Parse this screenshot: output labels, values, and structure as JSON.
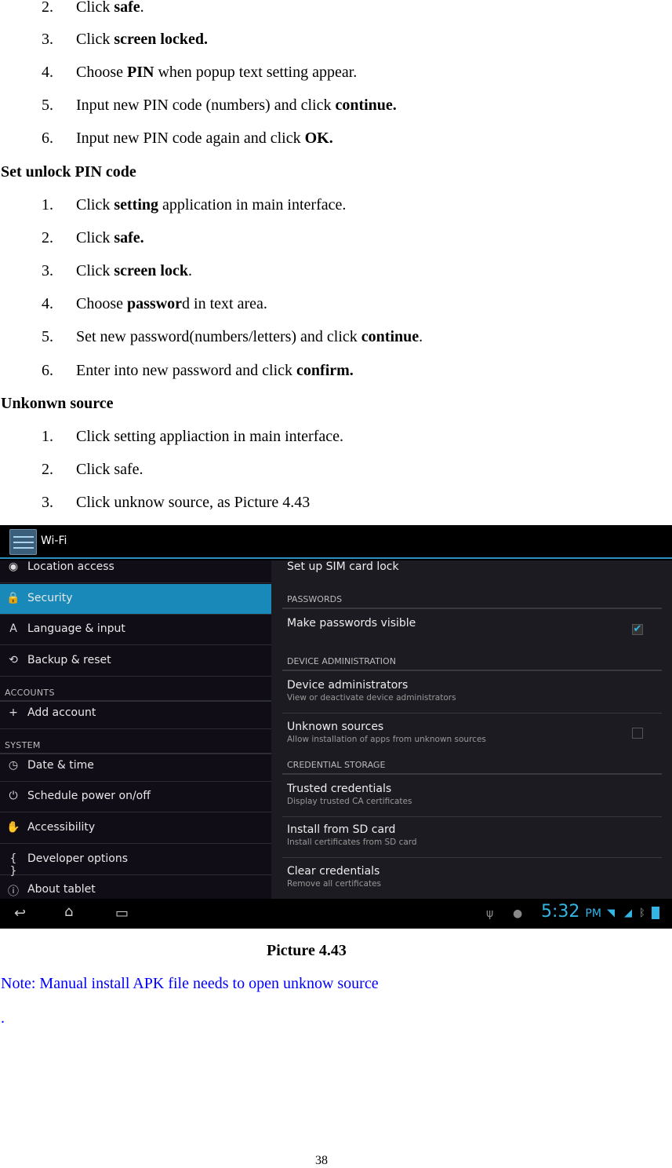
{
  "steps_a": [
    {
      "n": "2.",
      "parts": [
        [
          "Click ",
          0
        ],
        [
          "safe",
          1
        ],
        [
          ".",
          0
        ]
      ]
    },
    {
      "n": "3.",
      "parts": [
        [
          "Click ",
          0
        ],
        [
          "screen locked.",
          1
        ]
      ]
    },
    {
      "n": "4.",
      "parts": [
        [
          "Choose ",
          0
        ],
        [
          "PIN",
          1
        ],
        [
          " when popup text setting appear.",
          0
        ]
      ]
    },
    {
      "n": "5.",
      "parts": [
        [
          "Input new PIN code (numbers) and click ",
          0
        ],
        [
          "continue.",
          1
        ]
      ]
    },
    {
      "n": "6.",
      "parts": [
        [
          "Input new PIN code again and click ",
          0
        ],
        [
          "OK.",
          1
        ]
      ]
    }
  ],
  "heading_pin": "Set unlock PIN code",
  "steps_b": [
    {
      "n": "1.",
      "parts": [
        [
          "Click ",
          0
        ],
        [
          "setting",
          1
        ],
        [
          " application in main interface.",
          0
        ]
      ]
    },
    {
      "n": "2.",
      "parts": [
        [
          "Click ",
          0
        ],
        [
          "safe.",
          1
        ]
      ]
    },
    {
      "n": "3.",
      "parts": [
        [
          "Click ",
          0
        ],
        [
          "screen lock",
          1
        ],
        [
          ".",
          0
        ]
      ]
    },
    {
      "n": "4.",
      "parts": [
        [
          "Choose ",
          0
        ],
        [
          "passwor",
          1
        ],
        [
          "d in text area.",
          0
        ]
      ]
    },
    {
      "n": "5.",
      "parts": [
        [
          "Set new password(numbers/letters) and click ",
          0
        ],
        [
          "continue",
          1
        ],
        [
          ".",
          0
        ]
      ]
    },
    {
      "n": "6.",
      "parts": [
        [
          "Enter into new password and click ",
          0
        ],
        [
          "confirm.",
          1
        ]
      ]
    }
  ],
  "heading_unknown": "Unkonwn source",
  "steps_c": [
    {
      "n": "1.",
      "parts": [
        [
          "Click setting appliaction in main interface.",
          0
        ]
      ]
    },
    {
      "n": "2.",
      "parts": [
        [
          "Click safe.",
          0
        ]
      ]
    },
    {
      "n": "3.",
      "parts": [
        [
          "Click unknow source, as Picture 4.43",
          0
        ]
      ]
    }
  ],
  "screenshot": {
    "title": "Wi-Fi",
    "accent": "#1889b8",
    "left": [
      {
        "type": "item",
        "icon": "location-icon",
        "glyph": "◉",
        "label": "Location access"
      },
      {
        "type": "item",
        "icon": "lock-icon",
        "glyph": "🔒",
        "label": "Security",
        "selected": true
      },
      {
        "type": "item",
        "icon": "language-icon",
        "glyph": "A",
        "label": "Language & input"
      },
      {
        "type": "item",
        "icon": "backup-icon",
        "glyph": "⟲",
        "label": "Backup & reset"
      },
      {
        "type": "section",
        "label": "ACCOUNTS"
      },
      {
        "type": "item",
        "icon": "plus-icon",
        "glyph": "+",
        "label": "Add account"
      },
      {
        "type": "section",
        "label": "SYSTEM"
      },
      {
        "type": "item",
        "icon": "clock-icon",
        "glyph": "◷",
        "label": "Date & time"
      },
      {
        "type": "item",
        "icon": "power-schedule-icon",
        "glyph": "⏻",
        "label": "Schedule power on/off"
      },
      {
        "type": "item",
        "icon": "hand-icon",
        "glyph": "✋",
        "label": "Accessibility"
      },
      {
        "type": "item",
        "icon": "braces-icon",
        "glyph": "{ }",
        "label": "Developer options"
      },
      {
        "type": "item",
        "icon": "info-icon",
        "glyph": "ⓘ",
        "label": "About tablet"
      }
    ],
    "right": {
      "sim_lock": "Set up SIM card lock",
      "passwords_header": "PASSWORDS",
      "make_visible": "Make passwords visible",
      "make_visible_checked": true,
      "device_admin_header": "DEVICE ADMINISTRATION",
      "device_admins": {
        "title": "Device administrators",
        "sub": "View or deactivate device administrators"
      },
      "unknown": {
        "title": "Unknown sources",
        "sub": "Allow installation of apps from unknown sources",
        "checked": false
      },
      "cred_header": "CREDENTIAL STORAGE",
      "trusted": {
        "title": "Trusted credentials",
        "sub": "Display trusted CA certificates"
      },
      "install": {
        "title": "Install from SD card",
        "sub": "Install certificates from SD card"
      },
      "clear": {
        "title": "Clear credentials",
        "sub": "Remove all certificates"
      }
    },
    "status": {
      "time": "5:32",
      "ampm": "PM"
    }
  },
  "caption": "Picture 4.43",
  "note": "Note: Manual install APK file needs to open unknow source",
  "dot": ".",
  "page_number": "38"
}
